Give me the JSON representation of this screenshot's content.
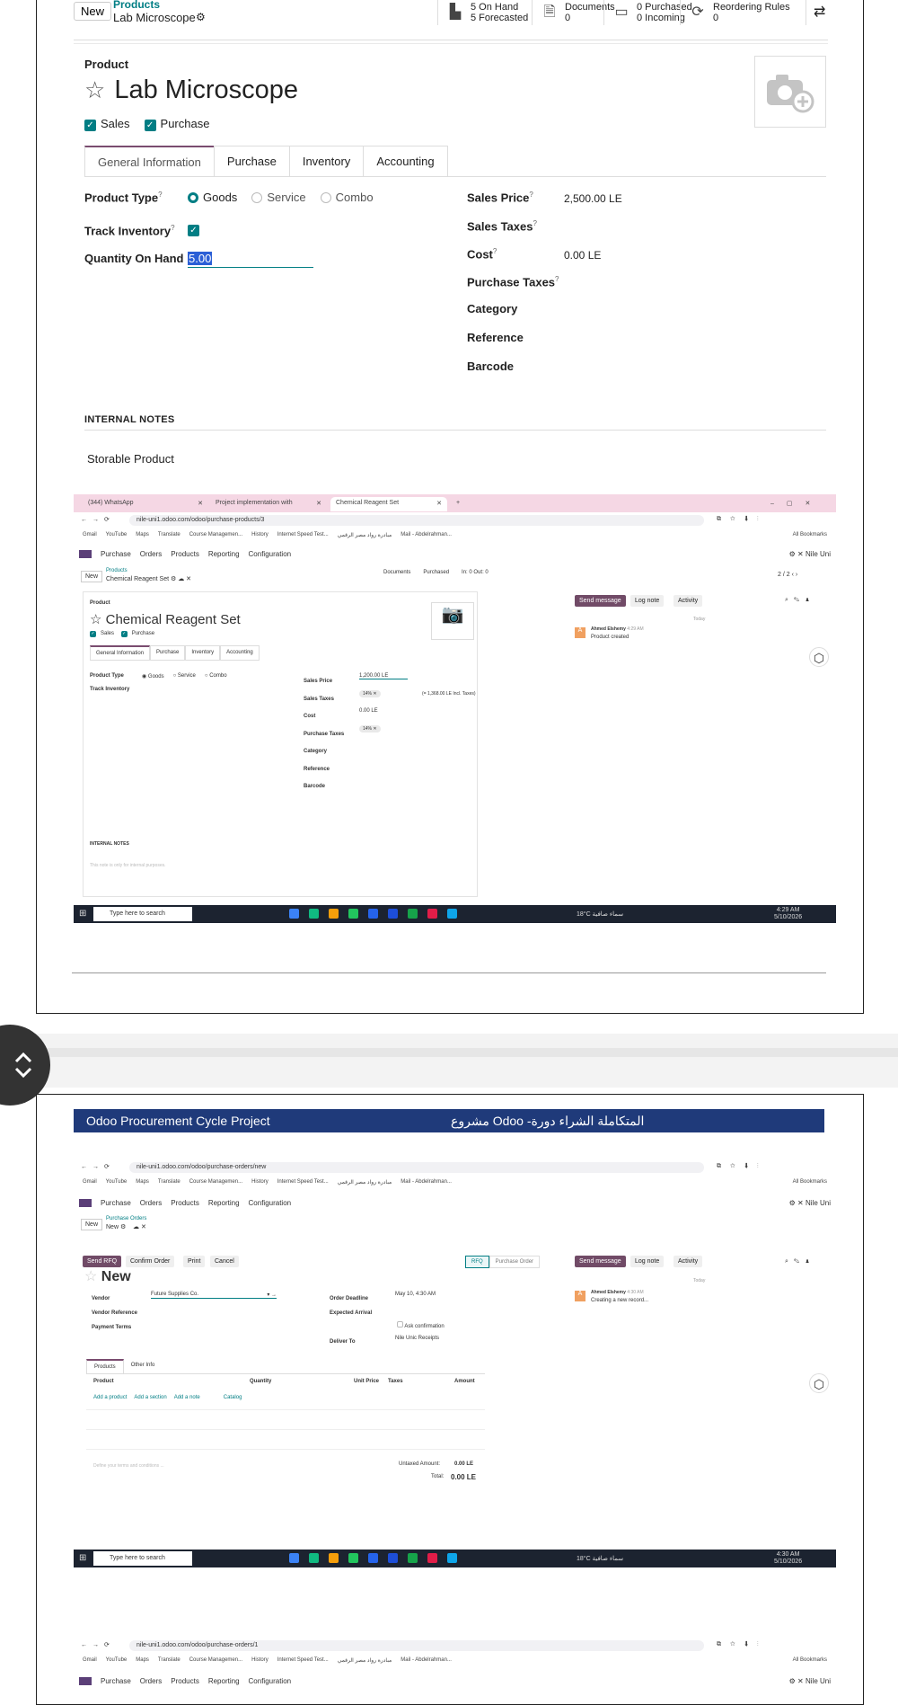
{
  "top_form": {
    "new_label": "New",
    "breadcrumb_parent": "Products",
    "breadcrumb_current": "Lab Microscope",
    "smart_buttons": [
      {
        "icon": "bar-chart-icon",
        "line1": "5 On Hand",
        "line2": "5 Forecasted"
      },
      {
        "icon": "document-icon",
        "line1": "Documents",
        "line2": "0"
      },
      {
        "icon": "card-icon",
        "line1": "0 Purchased",
        "line2": "0 Incoming"
      },
      {
        "icon": "refresh-icon",
        "line1": "Reordering Rules",
        "line2": "0"
      }
    ],
    "product_label": "Product",
    "product_name": "Lab Microscope",
    "sales_label": "Sales",
    "purchase_label": "Purchase",
    "tabs": [
      "General Information",
      "Purchase",
      "Inventory",
      "Accounting"
    ],
    "fields": {
      "product_type": "Product Type",
      "goods": "Goods",
      "service": "Service",
      "combo": "Combo",
      "track_inventory": "Track Inventory",
      "qty_on_hand": "Quantity On Hand",
      "qty_value": "5.00",
      "sales_price": "Sales Price",
      "sales_price_value": "2,500.00 LE",
      "sales_taxes": "Sales Taxes",
      "cost": "Cost",
      "cost_value": "0.00 LE",
      "purchase_taxes": "Purchase Taxes",
      "category": "Category",
      "reference": "Reference",
      "barcode": "Barcode"
    },
    "internal_notes_title": "INTERNAL NOTES",
    "internal_notes_value": "Storable Product"
  },
  "shot1": {
    "tabs": [
      "(344) WhatsApp",
      "Project implementation with",
      "Chemical Reagent Set"
    ],
    "url": "nile-uni1.odoo.com/odoo/purchase-products/3",
    "bookmarks": [
      "Gmail",
      "YouTube",
      "Maps",
      "Translate",
      "Course Managemen...",
      "History",
      "Internet Speed Test...",
      "مبادرة رواد مصر الرقمي",
      "Mail - Abdelrahman...",
      "All Bookmarks"
    ],
    "nav": [
      "Purchase",
      "Orders",
      "Products",
      "Reporting",
      "Configuration"
    ],
    "user": "Nile Uni",
    "new_label": "New",
    "bc_parent": "Products",
    "bc_current": "Chemical Reagent Set",
    "smart": [
      "Documents",
      "Purchased",
      "In: 0",
      "Out: 0"
    ],
    "pager": "2 / 2",
    "product_label": "Product",
    "product_name": "Chemical Reagent Set",
    "sales_label": "Sales",
    "purchase_label": "Purchase",
    "form_tabs": [
      "General Information",
      "Purchase",
      "Inventory",
      "Accounting"
    ],
    "product_type": "Product Type",
    "goods": "Goods",
    "service": "Service",
    "combo": "Combo",
    "track_inventory": "Track Inventory",
    "sales_price": "Sales Price",
    "sales_price_value": "1,200.00 LE",
    "sales_taxes": "Sales Taxes",
    "tax_tag": "14%",
    "incl_taxes": "(= 1,368.00 LE Incl. Taxes)",
    "cost": "Cost",
    "cost_value": "0.00 LE",
    "purchase_taxes": "Purchase Taxes",
    "category": "Category",
    "reference": "Reference",
    "barcode": "Barcode",
    "internal_notes": "INTERNAL NOTES",
    "notes_placeholder": "This note is only for internal purposes.",
    "send_message": "Send message",
    "log_note": "Log note",
    "activity": "Activity",
    "today": "Today",
    "author": "Ahmed Elshemy",
    "time": "4:29 AM",
    "message": "Product created",
    "search_placeholder": "Type here to search",
    "weather": "18°C",
    "weather_note": "سماء صافية",
    "clock_time": "4:29 AM",
    "clock_date": "5/10/2026"
  },
  "banner": {
    "left": "Odoo Procurement Cycle Project",
    "right": "مشروع Odoo -المتكاملة الشراء دورة"
  },
  "shot2": {
    "url": "nile-uni1.odoo.com/odoo/purchase-orders/new",
    "bookmarks": [
      "Gmail",
      "YouTube",
      "Maps",
      "Translate",
      "Course Managemen...",
      "History",
      "Internet Speed Test...",
      "مبادرة رواد مصر الرقمي",
      "Mail - Abdelrahman...",
      "All Bookmarks"
    ],
    "nav": [
      "Purchase",
      "Orders",
      "Products",
      "Reporting",
      "Configuration"
    ],
    "user": "Nile Uni",
    "new_label": "New",
    "bc_parent": "Purchase Orders",
    "bc_current": "New",
    "send_rfq": "Send RFQ",
    "confirm_order": "Confirm Order",
    "print": "Print",
    "cancel": "Cancel",
    "status_rfq": "RFQ",
    "status_po": "Purchase Order",
    "title": "New",
    "vendor": "Vendor",
    "vendor_value": "Future Supplies Co.",
    "vendor_ref": "Vendor Reference",
    "payment_terms": "Payment Terms",
    "order_deadline": "Order Deadline",
    "order_deadline_value": "May 10, 4:30 AM",
    "expected_arrival": "Expected Arrival",
    "ask_confirmation": "Ask confirmation",
    "deliver_to": "Deliver To",
    "deliver_to_value": "Nile Unic Receipts",
    "tabs": [
      "Products",
      "Other Info"
    ],
    "col_product": "Product",
    "col_quantity": "Quantity",
    "col_unit_price": "Unit Price",
    "col_taxes": "Taxes",
    "col_amount": "Amount",
    "add_product": "Add a product",
    "add_section": "Add a section",
    "add_note": "Add a note",
    "catalog": "Catalog",
    "terms_placeholder": "Define your terms and conditions ...",
    "untaxed_label": "Untaxed Amount:",
    "untaxed_value": "0.00 LE",
    "total_label": "Total:",
    "total_value": "0.00 LE",
    "send_message": "Send message",
    "log_note": "Log note",
    "activity": "Activity",
    "today": "Today",
    "author": "Ahmed Elshemy",
    "time": "4:30 AM",
    "message": "Creating a new record...",
    "search_placeholder": "Type here to search",
    "weather": "18°C",
    "weather_note": "سماء صافية",
    "clock_time": "4:30 AM",
    "clock_date": "5/10/2026"
  },
  "shot3": {
    "url": "nile-uni1.odoo.com/odoo/purchase-orders/1",
    "bookmarks": [
      "Gmail",
      "YouTube",
      "Maps",
      "Translate",
      "Course Managemen...",
      "History",
      "Internet Speed Test...",
      "مبادرة رواد مصر الرقمي",
      "Mail - Abdelrahman...",
      "All Bookmarks"
    ],
    "nav": [
      "Purchase",
      "Orders",
      "Products",
      "Reporting",
      "Configuration"
    ],
    "user": "Nile Uni"
  },
  "colors": {
    "odoo_purple": "#714B67",
    "odoo_teal": "#017e84",
    "banner_blue": "#1f3a7a",
    "chrome_pink": "#f5d7e4",
    "taskbar": "#1c2330"
  }
}
